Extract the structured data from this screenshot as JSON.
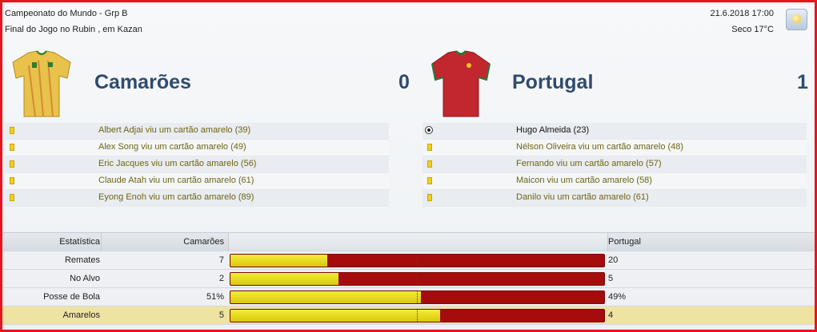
{
  "header": {
    "competition": "Campeonato do Mundo - Grp B",
    "venue": "Final do Jogo no Rubin , em Kazan",
    "datetime": "21.6.2018 17:00",
    "weather": "Seco 17°C",
    "weather_icon": "sun-icon"
  },
  "home": {
    "name": "Camarões",
    "score": "0",
    "shirt_color": "#e8c24a",
    "events": [
      {
        "type": "yellow-card",
        "text": "Albert Adjai viu um cartão amarelo (39)"
      },
      {
        "type": "yellow-card",
        "text": "Alex Song viu um cartão amarelo (49)"
      },
      {
        "type": "yellow-card",
        "text": "Eric Jacques viu um cartão amarelo (56)"
      },
      {
        "type": "yellow-card",
        "text": "Claude Atah viu um cartão amarelo (61)"
      },
      {
        "type": "yellow-card",
        "text": "Eyong Enoh viu um cartão amarelo (89)"
      }
    ]
  },
  "away": {
    "name": "Portugal",
    "score": "1",
    "shirt_color": "#c1272d",
    "events": [
      {
        "type": "goal",
        "text": "Hugo Almeida (23)"
      },
      {
        "type": "yellow-card",
        "text": "Nélson Oliveira viu um cartão amarelo (48)"
      },
      {
        "type": "yellow-card",
        "text": "Fernando viu um cartão amarelo (57)"
      },
      {
        "type": "yellow-card",
        "text": "Maicon viu um cartão amarelo (58)"
      },
      {
        "type": "yellow-card",
        "text": "Danilo viu um cartão amarelo (61)"
      }
    ]
  },
  "stats": {
    "header": {
      "label": "Estatística",
      "home": "Camarões",
      "away": "Portugal"
    },
    "rows": [
      {
        "label": "Remates",
        "home": "7",
        "away": "20",
        "home_share": 0.26
      },
      {
        "label": "No Alvo",
        "home": "2",
        "away": "5",
        "home_share": 0.29
      },
      {
        "label": "Posse de Bola",
        "home": "51%",
        "away": "49%",
        "home_share": 0.51
      },
      {
        "label": "Amarelos",
        "home": "5",
        "away": "4",
        "home_share": 0.56
      }
    ]
  },
  "colors": {
    "home_bar": "#e8dc1f",
    "away_bar": "#a50c0c",
    "title": "#2f4b6e",
    "frame": "#e8141e"
  }
}
